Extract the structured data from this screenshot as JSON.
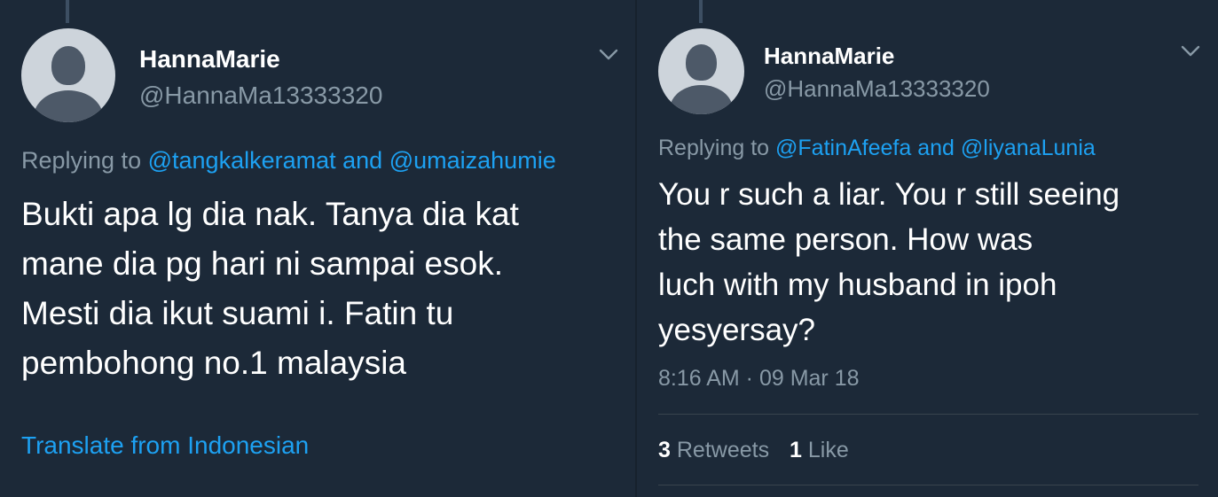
{
  "left_tweet": {
    "display_name": "HannaMarie",
    "handle": "@HannaMa13333320",
    "replying_prefix": "Replying to",
    "replying_user_1": "@tangkalkeramat",
    "replying_and": "and",
    "replying_user_2": "@umaizahumie",
    "text_lines": [
      "Bukti apa lg dia nak. Tanya dia kat",
      "mane dia pg hari ni sampai esok.",
      "Mesti dia ikut suami i. Fatin tu",
      "pembohong no.1 malaysia"
    ],
    "translate_label": "Translate from Indonesian"
  },
  "right_tweet": {
    "display_name": "HannaMarie",
    "handle": "@HannaMa13333320",
    "replying_prefix": "Replying to",
    "replying_user_1": "@FatinAfeefa",
    "replying_and": "and",
    "replying_user_2": "@liyanaLunia",
    "text_lines": [
      "You r such a liar. You r still seeing",
      "the same person. How was",
      "luch with my husband in ipoh",
      "yesyersay?"
    ],
    "timestamp": "8:16 AM · 09 Mar 18",
    "retweet_count": "3",
    "retweet_label": "Retweets",
    "like_count": "1",
    "like_label": "Like"
  },
  "icons": {
    "avatar": "default-profile-icon",
    "menu": "chevron-down-icon"
  },
  "colors": {
    "background": "#1c2938",
    "link": "#1da1f2",
    "secondary_text": "#8899a6",
    "primary_text": "#ffffff"
  }
}
